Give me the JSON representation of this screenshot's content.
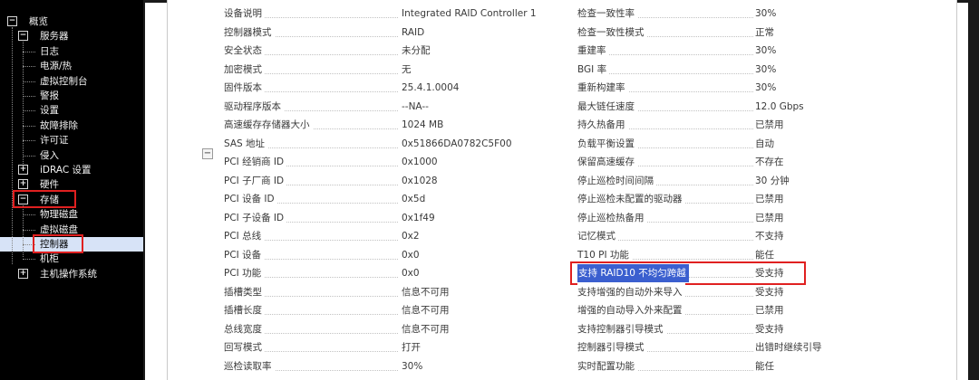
{
  "sidebar": {
    "items": [
      {
        "label": "概览",
        "toggle": "−"
      },
      {
        "label": "服务器",
        "toggle": "−"
      },
      {
        "label": "日志"
      },
      {
        "label": "电源/热"
      },
      {
        "label": "虚拟控制台"
      },
      {
        "label": "警报"
      },
      {
        "label": "设置"
      },
      {
        "label": "故障排除"
      },
      {
        "label": "许可证"
      },
      {
        "label": "侵入"
      },
      {
        "label": "iDRAC 设置",
        "toggle": "+"
      },
      {
        "label": "硬件",
        "toggle": "+"
      },
      {
        "label": "存储",
        "toggle": "−"
      },
      {
        "label": "物理磁盘"
      },
      {
        "label": "虚拟磁盘"
      },
      {
        "label": "控制器"
      },
      {
        "label": "机柜"
      },
      {
        "label": "主机操作系统",
        "toggle": "+"
      }
    ]
  },
  "main": {
    "collapse_symbol": "−",
    "left_rows": [
      {
        "label": "设备说明",
        "value": "Integrated RAID Controller 1"
      },
      {
        "label": "控制器模式",
        "value": "RAID"
      },
      {
        "label": "安全状态",
        "value": "未分配"
      },
      {
        "label": "加密模式",
        "value": "无"
      },
      {
        "label": "固件版本",
        "value": "25.4.1.0004"
      },
      {
        "label": "驱动程序版本",
        "value": "--NA--"
      },
      {
        "label": "高速缓存存储器大小",
        "value": "1024 MB"
      },
      {
        "label": "SAS 地址",
        "value": "0x51866DA0782C5F00"
      },
      {
        "label": "PCI 经销商 ID",
        "value": "0x1000"
      },
      {
        "label": "PCI 子厂商 ID",
        "value": "0x1028"
      },
      {
        "label": "PCI 设备 ID",
        "value": "0x5d"
      },
      {
        "label": "PCI 子设备 ID",
        "value": "0x1f49"
      },
      {
        "label": "PCI 总线",
        "value": "0x2"
      },
      {
        "label": "PCI 设备",
        "value": "0x0"
      },
      {
        "label": "PCI 功能",
        "value": "0x0"
      },
      {
        "label": "插槽类型",
        "value": "信息不可用"
      },
      {
        "label": "插槽长度",
        "value": "信息不可用"
      },
      {
        "label": "总线宽度",
        "value": "信息不可用"
      },
      {
        "label": "回写模式",
        "value": "打开"
      },
      {
        "label": "巡检读取率",
        "value": "30%"
      }
    ],
    "right_rows": [
      {
        "label": "检查一致性率",
        "value": "30%"
      },
      {
        "label": "检查一致性模式",
        "value": "正常"
      },
      {
        "label": "重建率",
        "value": "30%"
      },
      {
        "label": "BGI 率",
        "value": "30%"
      },
      {
        "label": "重新构建率",
        "value": "30%"
      },
      {
        "label": "最大链任速度",
        "value": "12.0 Gbps"
      },
      {
        "label": "持久热备用",
        "value": "已禁用"
      },
      {
        "label": "负载平衡设置",
        "value": "自动"
      },
      {
        "label": "保留高速缓存",
        "value": "不存在"
      },
      {
        "label": "停止巡检时间间隔",
        "value": "30 分钟"
      },
      {
        "label": "停止巡检未配置的驱动器",
        "value": "已禁用"
      },
      {
        "label": "停止巡检热备用",
        "value": "已禁用"
      },
      {
        "label": "记忆模式",
        "value": "不支持"
      },
      {
        "label": "T10 PI 功能",
        "value": "能任"
      },
      {
        "label": "支持 RAID10 不均匀跨越",
        "value": "受支持",
        "highlight": true
      },
      {
        "label": "支持增强的自动外来导入",
        "value": "受支持"
      },
      {
        "label": "增强的自动导入外来配置",
        "value": "已禁用"
      },
      {
        "label": "支持控制器引导模式",
        "value": "受支持"
      },
      {
        "label": "控制器引导模式",
        "value": "出错时继续引导"
      },
      {
        "label": "实时配置功能",
        "value": "能任"
      }
    ]
  },
  "colors": {
    "sidebar_bg": "#000000",
    "selection_bg": "#d7e3f7",
    "annotation_red": "#e02020",
    "text_highlight": "#3b5fcf"
  }
}
